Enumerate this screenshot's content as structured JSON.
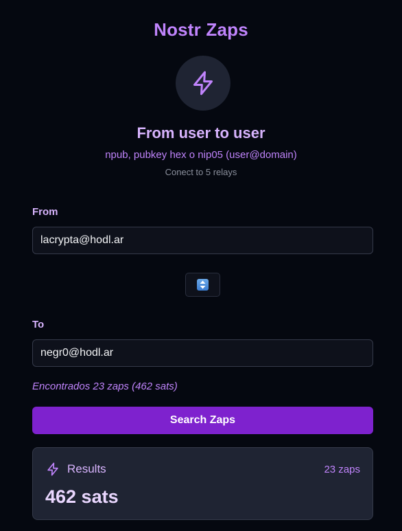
{
  "app": {
    "title": "Nostr Zaps"
  },
  "header": {
    "subtitle": "From user to user",
    "hint": "npub, pubkey hex o nip05 (user@domain)",
    "relays_text": "Conect to 5 relays"
  },
  "form": {
    "from_label": "From",
    "from_value": "lacrypta@hodl.ar",
    "to_label": "To",
    "to_value": "negr0@hodl.ar",
    "swap_icon": "up-down-arrow-icon",
    "status_text": "Encontrados 23 zaps (462 sats)",
    "search_label": "Search Zaps"
  },
  "results": {
    "label": "Results",
    "count": "23 zaps",
    "total": "462 sats",
    "icon": "lightning-icon"
  },
  "colors": {
    "background": "#050810",
    "accent": "#c084fc",
    "button": "#7e22ce",
    "card": "#1f2433"
  }
}
